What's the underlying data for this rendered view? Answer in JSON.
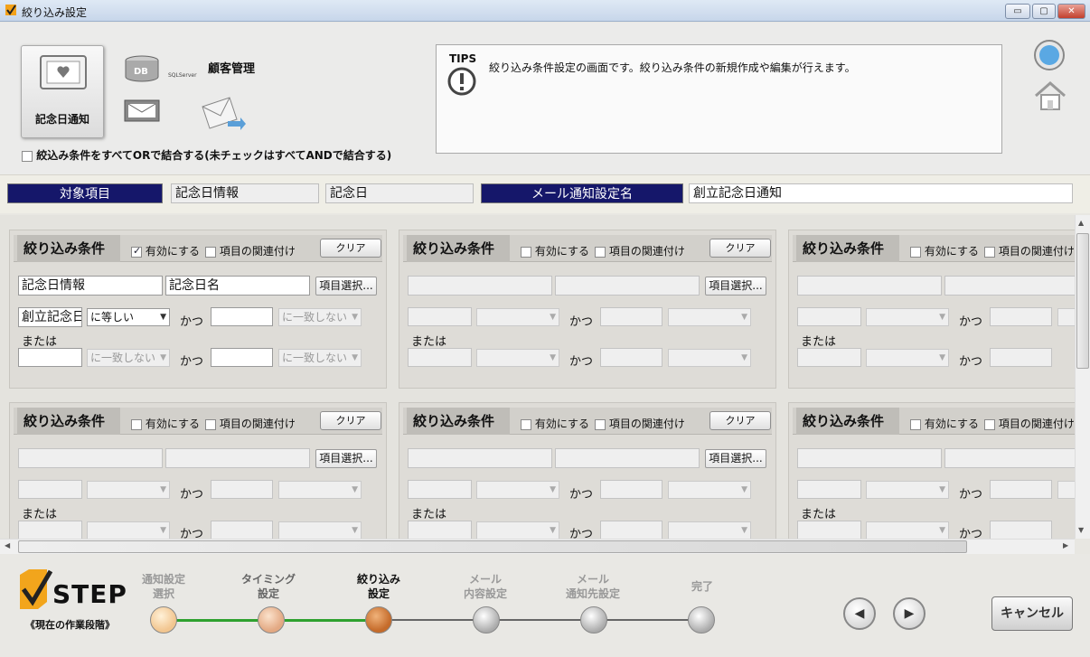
{
  "window": {
    "title": "絞り込み設定",
    "buttons": {
      "minimize": "▭",
      "maximize": "▢",
      "close": "✕"
    }
  },
  "top": {
    "anniversary_button": "記念日通知",
    "customer_label": "顧客管理",
    "sql_label": "SQLServer",
    "db_label": "DB",
    "or_checkbox_label": "絞込み条件をすべてORで結合する(未チェックはすべてANDで結合する)",
    "or_checked": false
  },
  "tips": {
    "label": "TIPS",
    "message": "絞り込み条件設定の画面です。絞り込み条件の新規作成や編集が行えます。"
  },
  "header": {
    "target_label": "対象項目",
    "target_value1": "記念日情報",
    "target_value2": "記念日",
    "mail_label": "メール通知設定名",
    "mail_value": "創立記念日通知"
  },
  "common": {
    "panel_title": "絞り込み条件",
    "enable": "有効にする",
    "relate": "項目の関連付け",
    "clear": "クリア",
    "select_item": "項目選択...",
    "and": "かつ",
    "or": "または",
    "no_match": "に一致しない"
  },
  "panel1": {
    "enabled": true,
    "field1": "記念日情報",
    "field2": "記念日名",
    "value1": "創立記念日",
    "operator1": "に等しい"
  },
  "steps": [
    {
      "label1": "通知設定",
      "label2": "選択",
      "color": "#f2c690"
    },
    {
      "label1": "タイミング",
      "label2": "設定",
      "color": "#e3a983"
    },
    {
      "label1": "絞り込み",
      "label2": "設定",
      "color": "#c56b2a"
    },
    {
      "label1": "メール",
      "label2": "内容設定",
      "color": "#bdbdbd"
    },
    {
      "label1": "メール",
      "label2": "通知先設定",
      "color": "#bdbdbd"
    },
    {
      "label1": "完了",
      "label2": "",
      "color": "#bdbdbd"
    }
  ],
  "step_logo": "STEP",
  "step_caption": "《現在の作業段階》",
  "nav": {
    "prev": "◀",
    "next": "▶"
  },
  "cancel": "キャンセル",
  "colors": {
    "header_label_bg": "#15176a",
    "progress_done": "#2fa12f",
    "progress_todo": "#666666"
  },
  "icons": [
    "app-icon",
    "heart-monitor-icon",
    "database-icon",
    "mail-icon",
    "mail-send-icon",
    "alert-icon",
    "help-icon",
    "home-icon",
    "step-logo-icon"
  ]
}
